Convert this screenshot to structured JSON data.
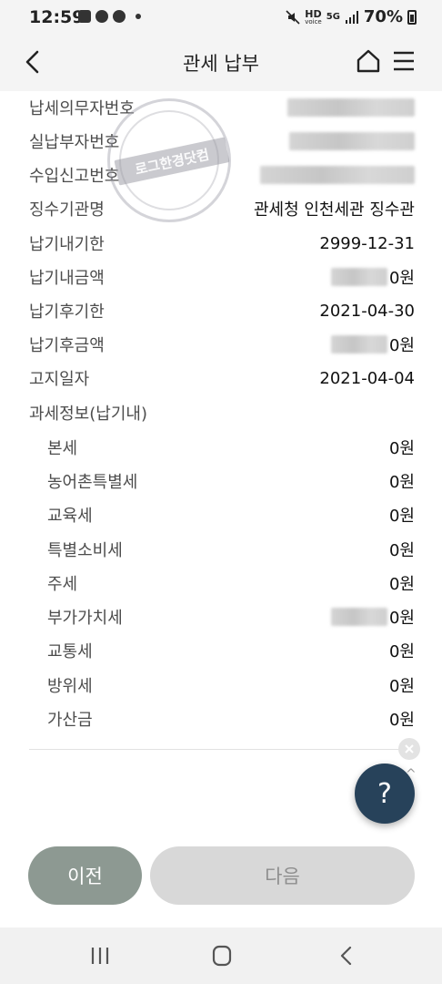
{
  "status_bar": {
    "time": "12:59",
    "network_label": "HD",
    "network_sub": "voice",
    "lte_label": "5G",
    "battery": "70%"
  },
  "header": {
    "title": "관세 납부"
  },
  "details": [
    {
      "label": "납세의무자번호",
      "value": ""
    },
    {
      "label": "실납부자번호",
      "value": ""
    },
    {
      "label": "수입신고번호",
      "value": ""
    },
    {
      "label": "징수기관명",
      "value": "관세청 인천세관 징수관"
    },
    {
      "label": "납기내기한",
      "value": "2999-12-31"
    },
    {
      "label": "납기내금액",
      "value": "0원"
    },
    {
      "label": "납기후기한",
      "value": "2021-04-30"
    },
    {
      "label": "납기후금액",
      "value": "0원"
    },
    {
      "label": "고지일자",
      "value": "2021-04-04"
    },
    {
      "label": "과세정보(납기내)",
      "value": ""
    }
  ],
  "tax_items": [
    {
      "label": "본세",
      "value": "0원"
    },
    {
      "label": "농어촌특별세",
      "value": "0원"
    },
    {
      "label": "교육세",
      "value": "0원"
    },
    {
      "label": "특별소비세",
      "value": "0원"
    },
    {
      "label": "주세",
      "value": "0원"
    },
    {
      "label": "부가가치세",
      "value": "0원"
    },
    {
      "label": "교통세",
      "value": "0원"
    },
    {
      "label": "방위세",
      "value": "0원"
    },
    {
      "label": "가산금",
      "value": "0원"
    }
  ],
  "watermark": {
    "text": "로그한경닷컴"
  },
  "help": {
    "label": "?"
  },
  "buttons": {
    "prev": "이전",
    "next": "다음"
  }
}
